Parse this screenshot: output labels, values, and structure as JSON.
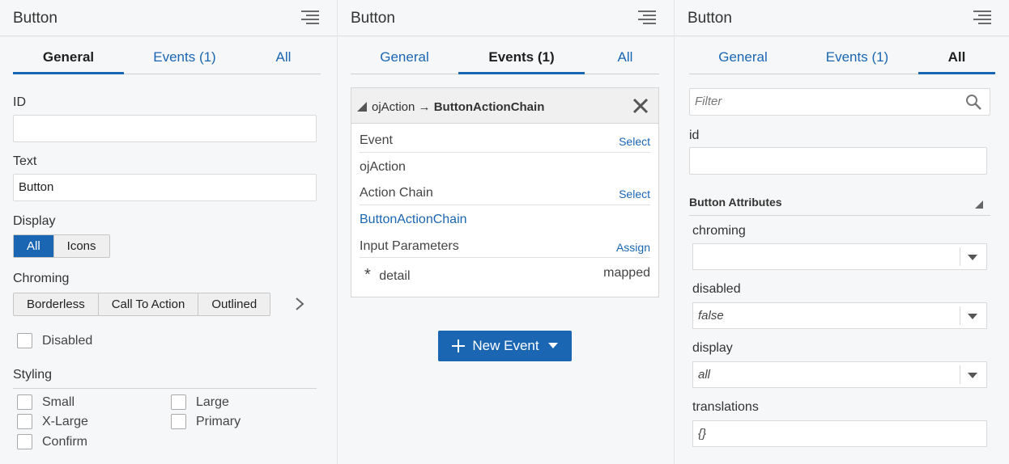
{
  "panels": [
    {
      "title": "Button",
      "tabs": [
        "General",
        "Events (1)",
        "All"
      ],
      "active_tab": 0,
      "general": {
        "id_label": "ID",
        "id_value": "",
        "text_label": "Text",
        "text_value": "Button",
        "display_label": "Display",
        "display_options": [
          "All",
          "Icons"
        ],
        "display_selected": "All",
        "chroming_label": "Chroming",
        "chroming_options": [
          "Borderless",
          "Call To Action",
          "Outlined"
        ],
        "disabled_label": "Disabled",
        "styling_label": "Styling",
        "styling_options": [
          "Small",
          "Large",
          "X-Large",
          "Primary",
          "Confirm"
        ]
      }
    },
    {
      "title": "Button",
      "tabs": [
        "General",
        "Events (1)",
        "All"
      ],
      "active_tab": 1,
      "events": {
        "event_name": "ojAction",
        "arrow": "→",
        "chain_name": "ButtonActionChain",
        "event_label": "Event",
        "event_action": "Select",
        "event_value": "ojAction",
        "chain_label": "Action Chain",
        "chain_action": "Select",
        "chain_value": "ButtonActionChain",
        "params_label": "Input Parameters",
        "params_action": "Assign",
        "param_name": "detail",
        "param_status": "mapped",
        "new_event_label": "New Event"
      }
    },
    {
      "title": "Button",
      "tabs": [
        "General",
        "Events (1)",
        "All"
      ],
      "active_tab": 2,
      "all": {
        "filter_placeholder": "Filter",
        "id_label": "id",
        "id_value": "",
        "section_title": "Button Attributes",
        "chroming_label": "chroming",
        "chroming_value": "",
        "disabled_label": "disabled",
        "disabled_value": "false",
        "display_label": "display",
        "display_value": "all",
        "translations_label": "translations",
        "translations_value": "{}"
      }
    }
  ],
  "colors": {
    "accent": "#1a66b3",
    "panel_bg": "#f6f7f8"
  }
}
